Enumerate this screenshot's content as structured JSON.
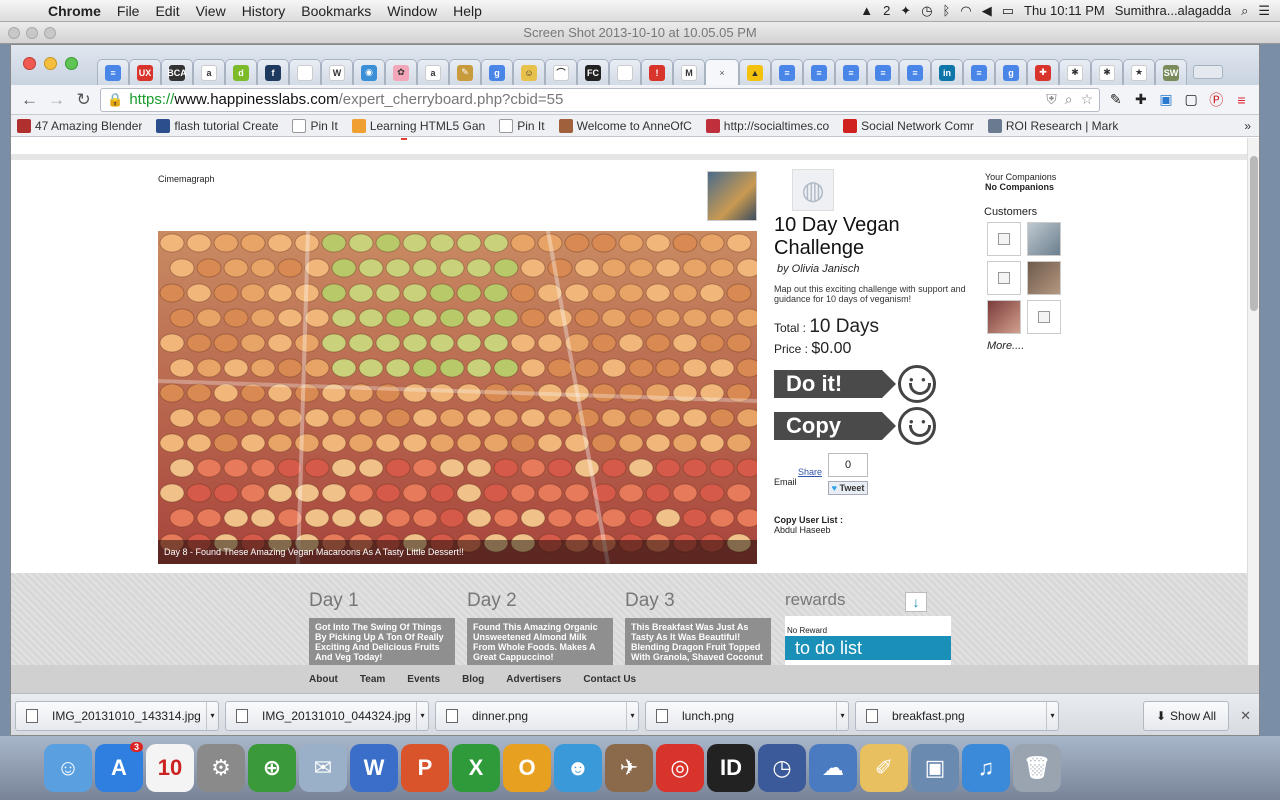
{
  "menubar": {
    "app": "Chrome",
    "items": [
      "File",
      "Edit",
      "View",
      "History",
      "Bookmarks",
      "Window",
      "Help"
    ],
    "status_num": "2",
    "clock": "Thu 10:11 PM",
    "user": "Sumithra...alagadda"
  },
  "preview": {
    "title": "Screen Shot 2013-10-10 at 10.05.05 PM"
  },
  "tabs": [
    {
      "icon": "docs-icon",
      "color": "#4a86e8",
      "glyph": "≡"
    },
    {
      "icon": "ux-icon",
      "color": "#d9342b",
      "glyph": "UX"
    },
    {
      "icon": "bca-icon",
      "color": "#333333",
      "glyph": "BCA"
    },
    {
      "icon": "amazon-icon",
      "color": "#ffffff",
      "glyph": "a"
    },
    {
      "icon": "d-icon",
      "color": "#7dbb2b",
      "glyph": "d"
    },
    {
      "icon": "f-icon",
      "color": "#1e3a5f",
      "glyph": "f"
    },
    {
      "icon": "page-icon",
      "color": "#ffffff",
      "glyph": ""
    },
    {
      "icon": "wikipedia-icon",
      "color": "#ffffff",
      "glyph": "W"
    },
    {
      "icon": "globe-icon",
      "color": "#3a8fd6",
      "glyph": "◉"
    },
    {
      "icon": "flower-icon",
      "color": "#f3a6b8",
      "glyph": "✿"
    },
    {
      "icon": "amazon-icon",
      "color": "#ffffff",
      "glyph": "a"
    },
    {
      "icon": "tool-icon",
      "color": "#c89b3c",
      "glyph": "✎"
    },
    {
      "icon": "google-icon",
      "color": "#4a86e8",
      "glyph": "g"
    },
    {
      "icon": "user-icon",
      "color": "#e8c14a",
      "glyph": "☺"
    },
    {
      "icon": "arc-icon",
      "color": "#ffffff",
      "glyph": "⌒"
    },
    {
      "icon": "fc-icon",
      "color": "#222222",
      "glyph": "FC"
    },
    {
      "icon": "page-icon",
      "color": "#ffffff",
      "glyph": ""
    },
    {
      "icon": "alert-icon",
      "color": "#d9342b",
      "glyph": "!"
    },
    {
      "icon": "gmail-icon",
      "color": "#ffffff",
      "glyph": "M"
    },
    {
      "icon": "close-tab-icon",
      "color": "",
      "glyph": "×",
      "active": true
    },
    {
      "icon": "drive-icon",
      "color": "#f4c20d",
      "glyph": "▲"
    },
    {
      "icon": "docs-icon",
      "color": "#4a86e8",
      "glyph": "≡"
    },
    {
      "icon": "docs-icon",
      "color": "#4a86e8",
      "glyph": "≡"
    },
    {
      "icon": "docs-icon",
      "color": "#4a86e8",
      "glyph": "≡"
    },
    {
      "icon": "docs-icon",
      "color": "#4a86e8",
      "glyph": "≡"
    },
    {
      "icon": "docs-icon",
      "color": "#4a86e8",
      "glyph": "≡"
    },
    {
      "icon": "linkedin-icon",
      "color": "#0e76a8",
      "glyph": "in"
    },
    {
      "icon": "docs-icon",
      "color": "#4a86e8",
      "glyph": "≡"
    },
    {
      "icon": "google-icon",
      "color": "#4a86e8",
      "glyph": "g"
    },
    {
      "icon": "red-icon",
      "color": "#d9342b",
      "glyph": "✚"
    },
    {
      "icon": "yelp-icon",
      "color": "#ffffff",
      "glyph": "✱"
    },
    {
      "icon": "yelp-icon",
      "color": "#ffffff",
      "glyph": "✱"
    },
    {
      "icon": "star-icon",
      "color": "#ffffff",
      "glyph": "★"
    },
    {
      "icon": "sw-icon",
      "color": "#7a8c5c",
      "glyph": "SW"
    }
  ],
  "address": {
    "scheme": "https://",
    "domain": "www.happinesslabs.com",
    "path": "/expert_cherryboard.php?cbid=55"
  },
  "bookmarks": [
    {
      "label": "47 Amazing Blender",
      "color": "#b03030"
    },
    {
      "label": "flash tutorial Create",
      "color": "#2b4e8c"
    },
    {
      "label": "Pin It",
      "color": "#ffffff"
    },
    {
      "label": "Learning HTML5 Gan",
      "color": "#f0a030"
    },
    {
      "label": "Pin It",
      "color": "#ffffff"
    },
    {
      "label": "Welcome to AnneOfC",
      "color": "#a0603c"
    },
    {
      "label": "http://socialtimes.co",
      "color": "#c0303c"
    },
    {
      "label": "Social Network Comr",
      "color": "#d02020"
    },
    {
      "label": "ROI Research | Mark",
      "color": "#6a7a90"
    }
  ],
  "page": {
    "cinemagraph_label": "Cimemagraph",
    "photo_caption": "Day 8 - Found These Amazing Vegan Macaroons As A Tasty Little Dessert!!",
    "challenge_title": "10 Day Vegan Challenge",
    "byline": "by Olivia Janisch",
    "description": "Map out this exciting challenge with support and guidance for 10 days of veganism!",
    "total_label": "Total :",
    "total_value": "10 Days",
    "price_label": "Price :",
    "price_value": "$0.00",
    "do_it_label": "Do it!",
    "copy_label": "Copy",
    "share_label": "Share",
    "email_label": "Email",
    "share_count": "0",
    "tweet_label": "Tweet",
    "copy_user_list_label": "Copy User List :",
    "copy_user": "Abdul Haseeb",
    "companions_label": "Your Companions",
    "companions_value": "No Companions",
    "customers_label": "Customers",
    "more_label": "More....",
    "days": [
      {
        "title": "Day 1",
        "text": "Got Into The Swing Of Things By Picking Up A Ton Of Really Exciting And Delicious Fruits And Veg Today!"
      },
      {
        "title": "Day 2",
        "text": "Found This Amazing Organic Unsweetened Almond Milk From Whole Foods. Makes A Great Cappuccino!"
      },
      {
        "title": "Day 3",
        "text": "This Breakfast Was Just As Tasty As It Was Beautiful! Blending Dragon Fruit Topped With Granola, Shaved Coconut"
      }
    ],
    "rewards_label": "rewards",
    "no_reward_label": "No Reward",
    "todo_label": "to do list",
    "footer_links": [
      "About",
      "Team",
      "Events",
      "Blog",
      "Advertisers",
      "Contact Us"
    ]
  },
  "downloads": {
    "files": [
      "IMG_20131010_143314.jpg",
      "IMG_20131010_044324.jpg",
      "dinner.png",
      "lunch.png",
      "breakfast.png"
    ],
    "show_all": "Show All"
  },
  "dock": [
    {
      "name": "finder-icon",
      "color": "#5aa0e0",
      "glyph": "☺"
    },
    {
      "name": "app-store-icon",
      "color": "#2f7fe0",
      "glyph": "A",
      "badge": "3"
    },
    {
      "name": "calendar-icon",
      "color": "#f4f4f4",
      "glyph": "10"
    },
    {
      "name": "system-preferences-icon",
      "color": "#8a8a8a",
      "glyph": "⚙"
    },
    {
      "name": "network-icon",
      "color": "#3a9a3a",
      "glyph": "⊕"
    },
    {
      "name": "preview-icon",
      "color": "#9ab0c8",
      "glyph": "✉"
    },
    {
      "name": "word-icon",
      "color": "#3a6ec8",
      "glyph": "W"
    },
    {
      "name": "powerpoint-icon",
      "color": "#d9542b",
      "glyph": "P"
    },
    {
      "name": "excel-icon",
      "color": "#2f9a3a",
      "glyph": "X"
    },
    {
      "name": "outlook-icon",
      "color": "#e8a020",
      "glyph": "O"
    },
    {
      "name": "messenger-icon",
      "color": "#3a9ad9",
      "glyph": "☻"
    },
    {
      "name": "hawk-icon",
      "color": "#8a6a4a",
      "glyph": "✈"
    },
    {
      "name": "chrome-icon",
      "color": "#d9342b",
      "glyph": "◎"
    },
    {
      "name": "id-icon",
      "color": "#222222",
      "glyph": "ID"
    },
    {
      "name": "time-machine-icon",
      "color": "#3a5a9a",
      "glyph": "◷"
    },
    {
      "name": "openoffice-icon",
      "color": "#4a7ac0",
      "glyph": "☁"
    },
    {
      "name": "pages-icon",
      "color": "#e8c060",
      "glyph": "✐"
    },
    {
      "name": "photos-icon",
      "color": "#6a8ab0",
      "glyph": "▣"
    },
    {
      "name": "itunes-icon",
      "color": "#3a8ad9",
      "glyph": "♫"
    },
    {
      "name": "trash-icon",
      "color": "#9aa4b0",
      "glyph": "🗑"
    }
  ]
}
